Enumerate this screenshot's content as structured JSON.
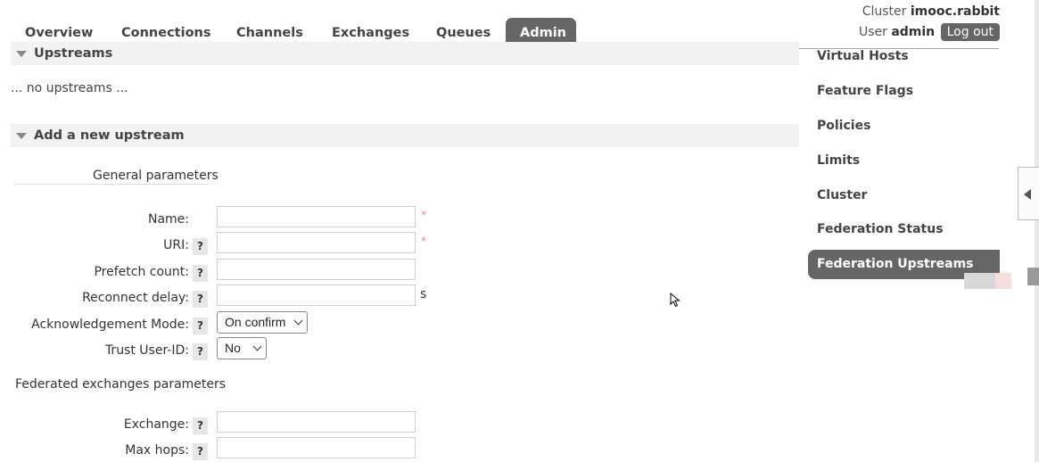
{
  "nav": {
    "tabs": [
      {
        "label": "Overview"
      },
      {
        "label": "Connections"
      },
      {
        "label": "Channels"
      },
      {
        "label": "Exchanges"
      },
      {
        "label": "Queues"
      },
      {
        "label": "Admin"
      }
    ],
    "active_tab": "Admin"
  },
  "user": {
    "cluster_label": "Cluster",
    "cluster_name": "imooc.rabbit",
    "user_label": "User",
    "user_name": "admin",
    "logout_label": "Log out"
  },
  "upstreams": {
    "title": "Upstreams",
    "empty_text": "... no upstreams ..."
  },
  "add_upstream": {
    "title": "Add a new upstream",
    "general_label": "General parameters",
    "fields": {
      "name": {
        "label": "Name:",
        "value": "",
        "required": "*"
      },
      "uri": {
        "label": "URI:",
        "value": "",
        "required": "*"
      },
      "prefetch": {
        "label": "Prefetch count:",
        "value": ""
      },
      "reconnect": {
        "label": "Reconnect delay:",
        "value": "",
        "unit": "s"
      },
      "ack_mode": {
        "label": "Acknowledgement Mode:",
        "selected": "On confirm"
      },
      "trust_user": {
        "label": "Trust User-ID:",
        "selected": "No"
      }
    },
    "federated_label": "Federated exchanges parameters",
    "fed_fields": {
      "exchange": {
        "label": "Exchange:",
        "value": ""
      },
      "max_hops": {
        "label": "Max hops:",
        "value": ""
      }
    },
    "help_glyph": "?"
  },
  "admin_menu": [
    {
      "label": "Virtual Hosts"
    },
    {
      "label": "Feature Flags"
    },
    {
      "label": "Policies"
    },
    {
      "label": "Limits"
    },
    {
      "label": "Cluster"
    },
    {
      "label": "Federation Status"
    },
    {
      "label": "Federation Upstreams"
    }
  ],
  "admin_menu_active": "Federation Upstreams"
}
